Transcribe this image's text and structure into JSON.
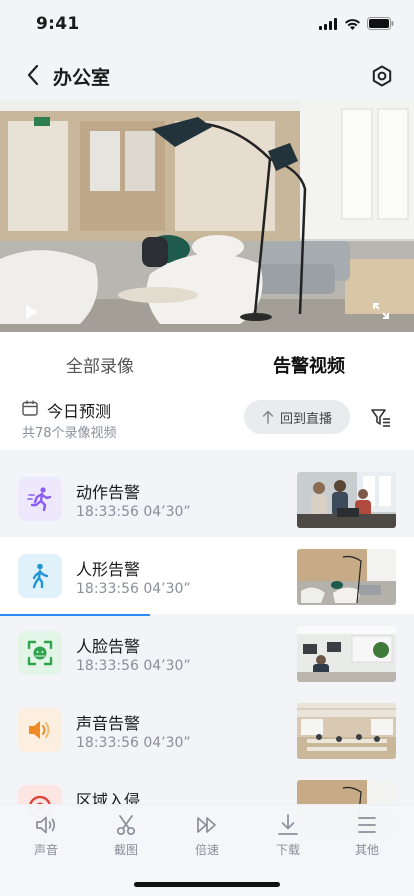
{
  "status_bar": {
    "time": "9:41",
    "icons": [
      "signal-icon",
      "wifi-icon",
      "battery-icon"
    ]
  },
  "nav": {
    "title": "办公室",
    "back_icon": "chevron-left-icon",
    "settings_icon": "settings-icon"
  },
  "video": {
    "play_icon": "play-icon",
    "fullscreen_icon": "fullscreen-icon"
  },
  "tabs": [
    {
      "label": "全部录像",
      "active": false
    },
    {
      "label": "告警视频",
      "active": true
    }
  ],
  "filter": {
    "date_label": "今日预测",
    "count_label": "共78个录像视频",
    "live_button": "回到直播"
  },
  "alerts": [
    {
      "name": "动作告警",
      "time": "18:33:56",
      "duration": "04’30”",
      "icon": "running-person-icon",
      "color": "#8b5cf6",
      "bg": "#ede8fb"
    },
    {
      "name": "人形告警",
      "time": "18:33:56",
      "duration": "04’30”",
      "icon": "walking-person-icon",
      "color": "#2196d3",
      "bg": "#e1f1fb"
    },
    {
      "name": "人脸告警",
      "time": "18:33:56",
      "duration": "04’30”",
      "icon": "face-scan-icon",
      "color": "#2ea44f",
      "bg": "#e2f5e6"
    },
    {
      "name": "声音告警",
      "time": "18:33:56",
      "duration": "04’30”",
      "icon": "speaker-icon",
      "color": "#f08a24",
      "bg": "#fdefe0"
    },
    {
      "name": "区域入侵",
      "time": "",
      "duration": "",
      "icon": "zone-icon",
      "color": "#e0453a",
      "bg": "#fce6e4"
    }
  ],
  "toolbar": [
    {
      "label": "声音",
      "icon": "volume-icon"
    },
    {
      "label": "截图",
      "icon": "scissors-icon"
    },
    {
      "label": "倍速",
      "icon": "fast-forward-icon"
    },
    {
      "label": "下载",
      "icon": "download-icon"
    },
    {
      "label": "其他",
      "icon": "menu-icon"
    }
  ]
}
